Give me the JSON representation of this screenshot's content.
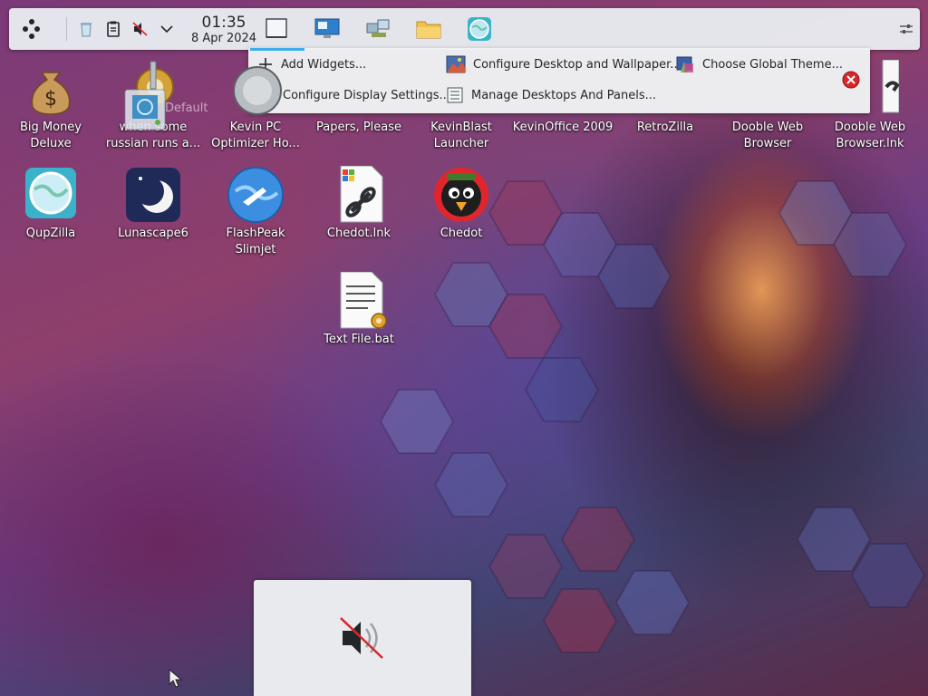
{
  "panel": {
    "clock": {
      "time": "01:35",
      "date": "8 Apr 2024"
    }
  },
  "toolbox": {
    "add_widgets": "Add Widgets...",
    "configure_wallpaper": "Configure Desktop and Wallpaper...",
    "global_theme": "Choose Global Theme...",
    "display_settings": "Configure Display Settings...",
    "manage_desktops": "Manage Desktops And Panels..."
  },
  "desktop": {
    "icons": [
      {
        "label": "Big Money Deluxe"
      },
      {
        "label": "when some russian runs a..."
      },
      {
        "label": "Kevin PC Optimizer Ho..."
      },
      {
        "label": "Papers, Please"
      },
      {
        "label": "KevinBlast Launcher"
      },
      {
        "label": "KevinOffice 2009"
      },
      {
        "label": "RetroZilla"
      },
      {
        "label": "Dooble Web Browser"
      },
      {
        "label": "Dooble Web Browser.lnk"
      },
      {
        "label": "QupZilla"
      },
      {
        "label": "Lunascape6"
      },
      {
        "label": "FlashPeak Slimjet"
      },
      {
        "label": "Chedot.lnk"
      },
      {
        "label": "Chedot"
      },
      {
        "label": "Text File.bat"
      }
    ],
    "drag_ghost_label": "Default"
  },
  "colors": {
    "accent": "#3daee9",
    "close_red": "#d9262c",
    "mute_slash": "#d9262c"
  }
}
